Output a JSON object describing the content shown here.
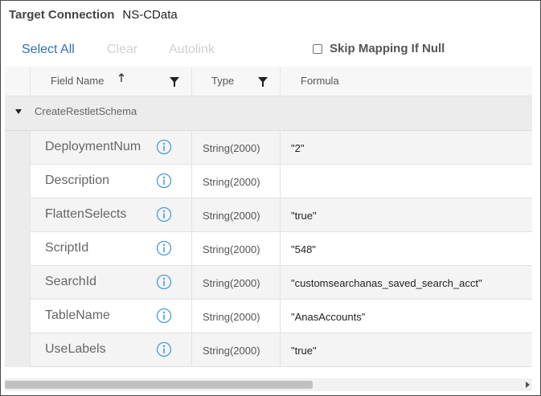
{
  "header": {
    "title_label": "Target Connection",
    "title_value": "NS-CData"
  },
  "toolbar": {
    "select_all": "Select All",
    "clear": "Clear",
    "autolink": "Autolink",
    "skip_mapping_label": "Skip Mapping If Null",
    "skip_mapping_checked": false
  },
  "grid": {
    "columns": {
      "field_name": "Field Name",
      "type": "Type",
      "formula": "Formula"
    },
    "group": {
      "name": "CreateRestletSchema",
      "expanded": true
    },
    "rows": [
      {
        "field": "DeploymentNum",
        "type": "String(2000)",
        "formula": "\"2\""
      },
      {
        "field": "Description",
        "type": "String(2000)",
        "formula": ""
      },
      {
        "field": "FlattenSelects",
        "type": "String(2000)",
        "formula": "\"true\""
      },
      {
        "field": "ScriptId",
        "type": "String(2000)",
        "formula": "\"548\""
      },
      {
        "field": "SearchId",
        "type": "String(2000)",
        "formula": "\"customsearchanas_saved_search_acct\""
      },
      {
        "field": "TableName",
        "type": "String(2000)",
        "formula": "\"AnasAccounts\""
      },
      {
        "field": "UseLabels",
        "type": "String(2000)",
        "formula": "\"true\""
      }
    ]
  },
  "colors": {
    "link": "#2f6fbe",
    "disabled": "#cfcfcf",
    "info_icon": "#4a9fd8"
  },
  "icons": {
    "sort": "arrow-up-icon",
    "filter": "funnel-icon",
    "group_toggle": "caret-down-icon",
    "info": "info-circle-icon",
    "scroll_right": "arrow-right-icon"
  }
}
